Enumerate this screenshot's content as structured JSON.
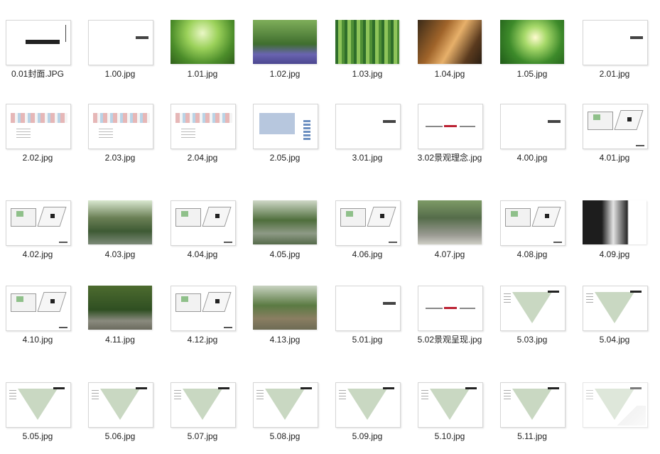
{
  "files": [
    {
      "name": "0.01封面.JPG",
      "kind": "cover"
    },
    {
      "name": "1.00.jpg",
      "kind": "blank"
    },
    {
      "name": "1.01.jpg",
      "kind": "photo-forest-canopy"
    },
    {
      "name": "1.02.jpg",
      "kind": "photo-bluebell-forest"
    },
    {
      "name": "1.03.jpg",
      "kind": "photo-bamboo"
    },
    {
      "name": "1.04.jpg",
      "kind": "photo-autumn-forest"
    },
    {
      "name": "1.05.jpg",
      "kind": "photo-sunlit-forest"
    },
    {
      "name": "2.01.jpg",
      "kind": "blank"
    },
    {
      "name": "2.02.jpg",
      "kind": "masterplan"
    },
    {
      "name": "2.03.jpg",
      "kind": "masterplan"
    },
    {
      "name": "2.04.jpg",
      "kind": "masterplan"
    },
    {
      "name": "2.05.jpg",
      "kind": "masterplan-blue"
    },
    {
      "name": "3.01.jpg",
      "kind": "blank"
    },
    {
      "name": "3.02景观理念.jpg",
      "kind": "text"
    },
    {
      "name": "4.00.jpg",
      "kind": "blank"
    },
    {
      "name": "4.01.jpg",
      "kind": "plan"
    },
    {
      "name": "4.02.jpg",
      "kind": "plan"
    },
    {
      "name": "4.03.jpg",
      "kind": "photo-garden-pond"
    },
    {
      "name": "4.04.jpg",
      "kind": "plan"
    },
    {
      "name": "4.05.jpg",
      "kind": "photo-garden-path"
    },
    {
      "name": "4.06.jpg",
      "kind": "plan"
    },
    {
      "name": "4.07.jpg",
      "kind": "photo-courtyard"
    },
    {
      "name": "4.08.jpg",
      "kind": "plan"
    },
    {
      "name": "4.09.jpg",
      "kind": "photo-doorway"
    },
    {
      "name": "4.10.jpg",
      "kind": "plan"
    },
    {
      "name": "4.11.jpg",
      "kind": "photo-bamboo-path"
    },
    {
      "name": "4.12.jpg",
      "kind": "plan"
    },
    {
      "name": "4.13.jpg",
      "kind": "photo-stream-garden"
    },
    {
      "name": "5.01.jpg",
      "kind": "blank"
    },
    {
      "name": "5.02景观呈现.jpg",
      "kind": "text"
    },
    {
      "name": "5.03.jpg",
      "kind": "site"
    },
    {
      "name": "5.04.jpg",
      "kind": "site"
    },
    {
      "name": "5.05.jpg",
      "kind": "site"
    },
    {
      "name": "5.06.jpg",
      "kind": "site"
    },
    {
      "name": "5.07.jpg",
      "kind": "site"
    },
    {
      "name": "5.08.jpg",
      "kind": "site"
    },
    {
      "name": "5.09.jpg",
      "kind": "site"
    },
    {
      "name": "5.10.jpg",
      "kind": "site"
    },
    {
      "name": "5.11.jpg",
      "kind": "site"
    },
    {
      "name": "",
      "kind": "site-faded"
    }
  ]
}
